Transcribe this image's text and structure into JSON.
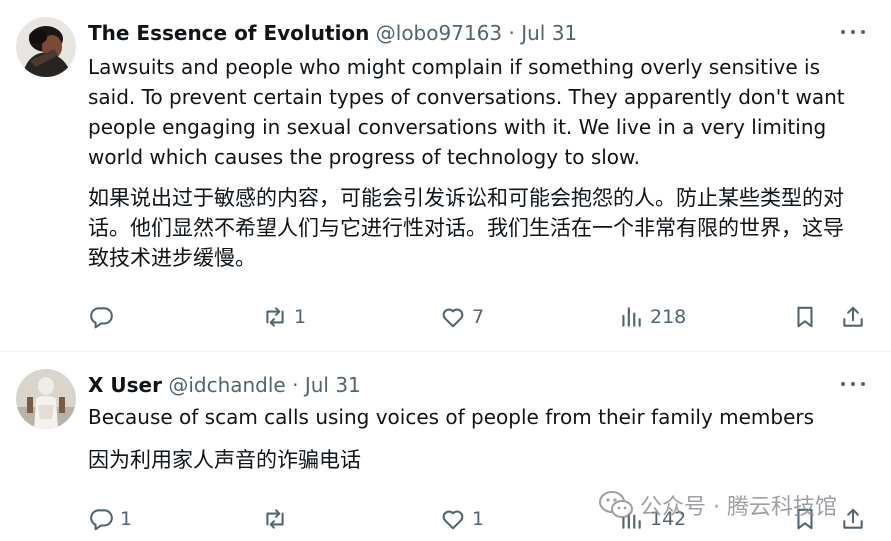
{
  "tweets": [
    {
      "author_name": "The Essence of Evolution",
      "handle": "@lobo97163",
      "separator": "·",
      "date": "Jul 31",
      "text_en": "Lawsuits and people who might complain if something overly sensitive is said. To prevent certain types of conversations. They apparently don't want people engaging in sexual conversations with it. We live in a very limiting world which causes the progress of technology to slow.",
      "text_zh": "如果说出过于敏感的内容，可能会引发诉讼和可能会抱怨的人。防止某些类型的对话。他们显然不希望人们与它进行性对话。我们生活在一个非常有限的世界，这导致技术进步缓慢。",
      "replies": "",
      "reposts": "1",
      "likes": "7",
      "views": "218"
    },
    {
      "author_name": "X User",
      "handle": "@idchandle",
      "separator": "·",
      "date": "Jul 31",
      "text_en": "Because of scam calls using voices of people from their family members",
      "text_zh": "因为利用家人声音的诈骗电话",
      "replies": "1",
      "reposts": "",
      "likes": "1",
      "views": "142"
    }
  ],
  "watermark": {
    "text": "公众号 · 腾云科技馆",
    "icon": "wechat-icon"
  },
  "icons": {
    "reply": "reply-icon",
    "repost": "repost-icon",
    "like": "heart-icon",
    "views": "views-icon",
    "bookmark": "bookmark-icon",
    "share": "share-icon",
    "more": "more-icon"
  },
  "colors": {
    "text": "#0f1419",
    "secondary": "#536471",
    "divider": "#eff3f4"
  }
}
